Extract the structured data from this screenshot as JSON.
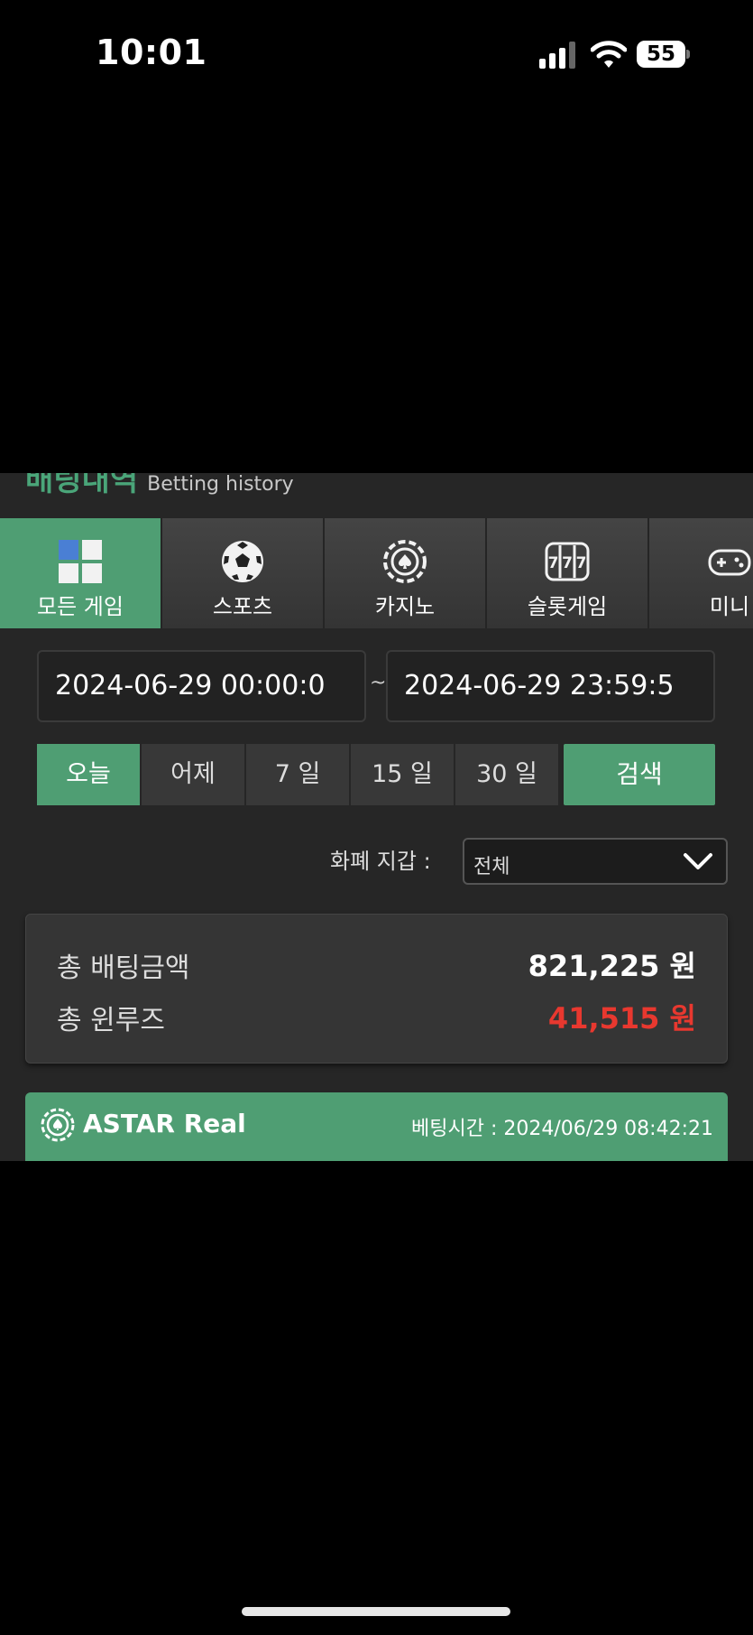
{
  "status_bar": {
    "time": "10:01",
    "battery": "55"
  },
  "header": {
    "title_ko": "배팅내역",
    "title_en": "Betting history"
  },
  "category_tabs": [
    {
      "label": "모든 게임",
      "icon": "all-games-icon",
      "active": true
    },
    {
      "label": "스포츠",
      "icon": "soccer-ball-icon",
      "active": false
    },
    {
      "label": "카지노",
      "icon": "casino-chip-icon",
      "active": false
    },
    {
      "label": "슬롯게임",
      "icon": "slot-machine-icon",
      "active": false
    },
    {
      "label": "미니",
      "icon": "gamepad-icon",
      "active": false
    }
  ],
  "date_range": {
    "start": "2024-06-29 00:00:0",
    "separator": "~",
    "end": "2024-06-29 23:59:5"
  },
  "range_buttons": [
    "오늘",
    "어제",
    "7 일",
    "15 일",
    "30 일"
  ],
  "search_label": "검색",
  "wallet_filter": {
    "label": "화폐 지갑 :",
    "selected": "전체"
  },
  "summary": {
    "total_bet_label": "총 배팅금액",
    "total_bet_value": "821,225 원",
    "total_winloss_label": "총 윈루즈",
    "total_winloss_value": "41,515 원"
  },
  "bet_card": {
    "provider": "ASTAR Real",
    "time_text": "베팅시간 : 2024/06/29 08:42:21"
  },
  "colors": {
    "accent": "#4f9e73",
    "loss": "#e8382f",
    "panel": "#262626"
  }
}
